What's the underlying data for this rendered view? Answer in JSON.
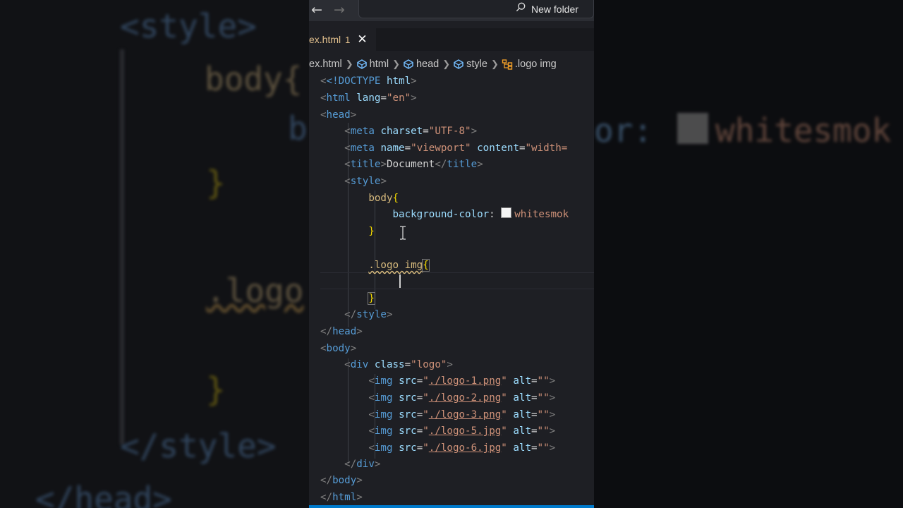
{
  "background": {
    "left_lines": [
      {
        "text": "<style>",
        "color": "#4b6f99"
      },
      {
        "text": "body{",
        "color": "#9c8760"
      },
      {
        "text": "b",
        "color": "#4b6f99"
      },
      {
        "text": "}",
        "color": "#9c8a10"
      },
      {
        "text": ".logo",
        "color": "#9c8760"
      },
      {
        "text": "}",
        "color": "#9c8a10"
      },
      {
        "text": "</style>",
        "color": "#4b6f99"
      },
      {
        "text": "</head>",
        "color": "#4b6f99"
      }
    ],
    "right_text_1": "or:",
    "right_text_2": "whitesmok"
  },
  "titlebar": {
    "back_icon": "back-arrow-icon",
    "forward_icon": "forward-arrow-icon",
    "search_label": "New folder"
  },
  "tab": {
    "name": "ex.html",
    "problems": "1",
    "close": "✕"
  },
  "breadcrumb": [
    {
      "label": "ex.html",
      "icon": ""
    },
    {
      "label": "html",
      "icon": "element-icon"
    },
    {
      "label": "head",
      "icon": "element-icon"
    },
    {
      "label": "style",
      "icon": "element-icon"
    },
    {
      "label": ".logo img",
      "icon": "css-rule-icon"
    }
  ],
  "code": {
    "doctype_open": "<!DOCTYPE",
    "doctype_html": " html",
    "doctype_close": ">",
    "html_lang": "en",
    "charset": "UTF-8",
    "meta_name": "viewport",
    "meta_content_partial": "width=",
    "title_text": "Document",
    "body_selector": "body",
    "bg_property": "background-color",
    "bg_value": "whitesmok",
    "logo_selector": ".logo img",
    "div_class": "logo",
    "images": [
      {
        "src": "./logo-1.png",
        "alt": ""
      },
      {
        "src": "./logo-2.png",
        "alt": ""
      },
      {
        "src": "./logo-3.png",
        "alt": ""
      },
      {
        "src": "./logo-5.jpg",
        "alt": ""
      },
      {
        "src": "./logo-6.jpg",
        "alt": ""
      }
    ]
  },
  "colors": {
    "editor_bg": "#1e1f24",
    "tag": "#569cd6",
    "attribute": "#9cdcfe",
    "string": "#ce9178",
    "selector": "#d7ba7d",
    "brace": "#f1d700",
    "accent": "#007acc"
  }
}
